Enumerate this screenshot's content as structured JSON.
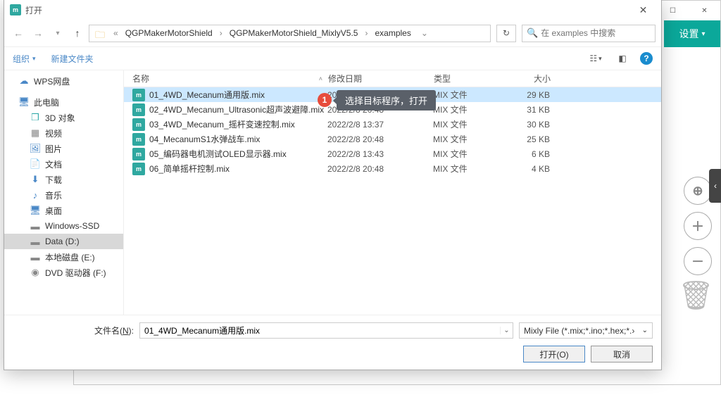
{
  "bg": {
    "settings": "设置",
    "tools": {
      "target": "⊕",
      "plus": "＋",
      "minus": "－"
    },
    "trash": "🗑"
  },
  "dialog": {
    "title": "打开",
    "breadcrumb": {
      "prefix": "«",
      "p1": "QGPMakerMotorShield",
      "p2": "QGPMakerMotorShield_MixlyV5.5",
      "p3": "examples"
    },
    "search_placeholder": "在 examples 中搜索",
    "toolbar": {
      "organize": "组织",
      "newfolder": "新建文件夹"
    },
    "columns": {
      "name": "名称",
      "date": "修改日期",
      "type": "类型",
      "size": "大小"
    },
    "tree": {
      "wps": "WPS网盘",
      "pc": "此电脑",
      "d3d": "3D 对象",
      "video": "视频",
      "pic": "图片",
      "doc": "文档",
      "dl": "下载",
      "music": "音乐",
      "desk": "桌面",
      "ssd": "Windows-SSD",
      "data": "Data (D:)",
      "local": "本地磁盘 (E:)",
      "dvd": "DVD 驱动器 (F:)"
    },
    "files": [
      {
        "name": "01_4WD_Mecanum通用版.mix",
        "date": "2022/2/8 20:48",
        "type": "MIX 文件",
        "size": "29 KB"
      },
      {
        "name": "02_4WD_Mecanum_Ultrasonic超声波避障.mix",
        "date": "2022/2/8 20:48",
        "type": "MIX 文件",
        "size": "31 KB"
      },
      {
        "name": "03_4WD_Mecanum_摇杆变速控制.mix",
        "date": "2022/2/8 13:37",
        "type": "MIX 文件",
        "size": "30 KB"
      },
      {
        "name": "04_MecanumS1水弹战车.mix",
        "date": "2022/2/8 20:48",
        "type": "MIX 文件",
        "size": "25 KB"
      },
      {
        "name": "05_编码器电机测试OLED显示器.mix",
        "date": "2022/2/8 13:43",
        "type": "MIX 文件",
        "size": "6 KB"
      },
      {
        "name": "06_简单摇杆控制.mix",
        "date": "2022/2/8 20:48",
        "type": "MIX 文件",
        "size": "4 KB"
      }
    ],
    "callout": {
      "num": "1",
      "text": "选择目标程序，打开"
    },
    "footer": {
      "fname_label_pre": "文件名(",
      "fname_label_u": "N",
      "fname_label_post": "):",
      "fname_value": "01_4WD_Mecanum通用版.mix",
      "filter": "Mixly File (*.mix;*.ino;*.hex;*.›",
      "open": "打开(O)",
      "cancel": "取消"
    }
  }
}
